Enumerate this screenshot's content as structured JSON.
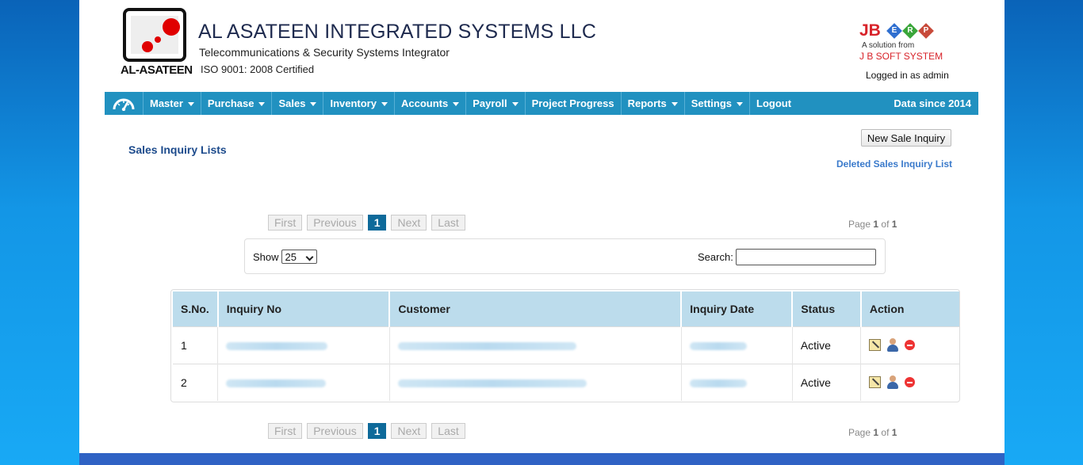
{
  "header": {
    "logo_text": "AL-ASATEEN",
    "company": "AL ASATEEN INTEGRATED SYSTEMS LLC",
    "tagline": "Telecommunications & Security Systems Integrator",
    "iso": "ISO 9001: 2008 Certified",
    "jb": "JB",
    "erp_letters": [
      "E",
      "R",
      "P"
    ],
    "solution_line1": "A solution from",
    "solution_line2": "J B SOFT SYSTEM",
    "logged_in": "Logged in as admin"
  },
  "nav": {
    "items": [
      {
        "label": "Master",
        "dropdown": true
      },
      {
        "label": "Purchase",
        "dropdown": true
      },
      {
        "label": "Sales",
        "dropdown": true
      },
      {
        "label": "Inventory",
        "dropdown": true
      },
      {
        "label": "Accounts",
        "dropdown": true
      },
      {
        "label": "Payroll",
        "dropdown": true
      },
      {
        "label": "Project Progress",
        "dropdown": false
      },
      {
        "label": "Reports",
        "dropdown": true
      },
      {
        "label": "Settings",
        "dropdown": true
      },
      {
        "label": "Logout",
        "dropdown": false
      }
    ],
    "right_text": "Data since 2014"
  },
  "page": {
    "title": "Sales Inquiry Lists",
    "new_button": "New Sale Inquiry",
    "deleted_link": "Deleted Sales Inquiry List"
  },
  "pager": {
    "first": "First",
    "previous": "Previous",
    "current": "1",
    "next": "Next",
    "last": "Last",
    "info_prefix": "Page",
    "page": "1",
    "of": "of",
    "total": "1"
  },
  "filter": {
    "show_label": "Show",
    "show_value": "25",
    "search_label": "Search:",
    "search_value": ""
  },
  "table": {
    "headers": [
      "S.No.",
      "Inquiry No",
      "Customer",
      "Inquiry Date",
      "Status",
      "Action"
    ],
    "rows": [
      {
        "sno": "1",
        "status": "Active"
      },
      {
        "sno": "2",
        "status": "Active"
      }
    ]
  },
  "colors": {
    "nav_bg": "#2191c0",
    "title_color": "#1d4b8c",
    "link_color": "#3a7acb",
    "header_bg": "#bcdcec",
    "footer_bar": "#2f62c4"
  }
}
